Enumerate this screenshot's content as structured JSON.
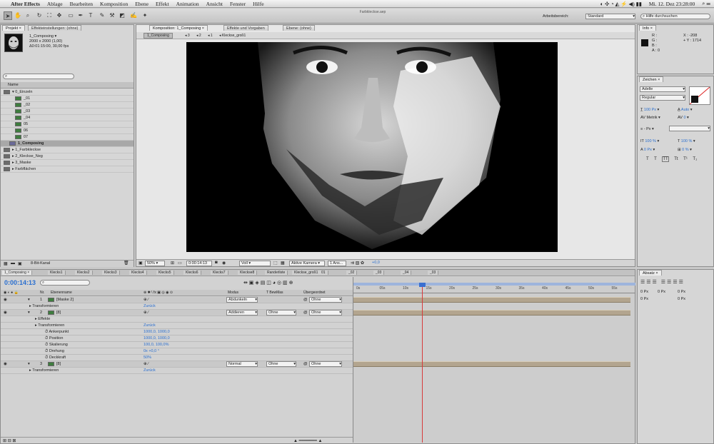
{
  "menubar": {
    "apple": "",
    "app": "After Effects",
    "items": [
      "Ablage",
      "Bearbeiten",
      "Komposition",
      "Ebene",
      "Effekt",
      "Animation",
      "Ansicht",
      "Fenster",
      "Hilfe"
    ],
    "clock": "Mi. 12. Dez  23:28:00"
  },
  "toolbar": {
    "file_title": "Farbkleckse.aep",
    "workspace_label": "Arbeitsbereich:",
    "workspace_value": "Standard",
    "help_placeholder": "Hilfe durchsuchen"
  },
  "project": {
    "tab1": "Projekt ×",
    "tab2": "Effekteinstellungen: (ohne)",
    "comp_name": "1_Composing ▾",
    "comp_size": "2000 x 2000 (1,00)",
    "comp_dur": "Δ0:01:15:00, 30,00 fps",
    "search_placeholder": "",
    "col_name": "Name",
    "items": [
      {
        "label": "▾ 0_Einzeln",
        "kind": "folder",
        "indent": 0
      },
      {
        "label": "_01",
        "kind": "img",
        "indent": 2
      },
      {
        "label": "_02",
        "kind": "img",
        "indent": 2
      },
      {
        "label": "_03",
        "kind": "img",
        "indent": 2
      },
      {
        "label": "_04",
        "kind": "img",
        "indent": 2
      },
      {
        "label": "05",
        "kind": "img",
        "indent": 2
      },
      {
        "label": "06",
        "kind": "img",
        "indent": 2
      },
      {
        "label": "07",
        "kind": "img",
        "indent": 2
      },
      {
        "label": "1_Composing",
        "kind": "comp",
        "indent": 1,
        "selected": true
      },
      {
        "label": "▸ 1_Farbkleckse",
        "kind": "folder",
        "indent": 0
      },
      {
        "label": "▸ 2_Kleckse_Neg",
        "kind": "folder",
        "indent": 0
      },
      {
        "label": "▸ 3_Maske",
        "kind": "folder",
        "indent": 0
      },
      {
        "label": "▸ Farbflächen",
        "kind": "folder",
        "indent": 0
      }
    ],
    "bpc": "8-Bit-Kanal"
  },
  "comp": {
    "tab1": "Komposition: 1_Composing ×",
    "tab2": "Effekte und Vorgaben",
    "tab3": "Ebene: (ohne)",
    "breadcrumb": [
      "1_Composing",
      "3",
      "2",
      "1",
      "Kleckse_groß1"
    ],
    "zoom": "50%",
    "time": "0:00:14:13",
    "quality": "Voll",
    "camera": "Aktive Kamera",
    "views": "1 Ans...",
    "exposure": "+0,0"
  },
  "info": {
    "tab": "Info ×",
    "r": "R :",
    "g": "G :",
    "b": "B :",
    "a": "A :  0",
    "x": "X : -208",
    "y": "+ Y : 1714"
  },
  "zeichen": {
    "tab": "Zeichen ×",
    "font": "Adelle",
    "style": "Regular",
    "size": "100 Px",
    "leading": "Auto",
    "kerning": "Metrik",
    "tracking": "0",
    "stroke": "- Px",
    "vscale": "100 %",
    "hscale": "100 %",
    "baseline": "0 Px",
    "tsume": "0 %",
    "styles": [
      "T",
      "T",
      "TT",
      "Tt",
      "T¹",
      "T₁"
    ]
  },
  "absatz": {
    "tab": "Absatz ×",
    "v1": "0 Px",
    "v2": "0 Px",
    "v3": "0 Px",
    "v4": "0 Px",
    "v5": "0 Px"
  },
  "timeline": {
    "tabs": [
      "1_Composing ×",
      "Klecks1",
      "Klecks2",
      "Klecks3",
      "Klecks4",
      "Klecks5",
      "Klecks6",
      "Klecks7",
      "Kleckse8",
      "Randerliste",
      "Kleckse_groß1",
      "01",
      "_02",
      "_03",
      "_04",
      "_03"
    ],
    "time": "0:00:14:13",
    "cols": {
      "num": "Nr.",
      "name": "Ebenenname",
      "switches": "⊕ ✱ \\ fx ▣ ◎ ◉ ⊙",
      "mode": "Modus",
      "trkmat": "T BewMas",
      "parent": "Übergeordnet"
    },
    "ruler": [
      "0s",
      "05s",
      "10s",
      "15s",
      "20s",
      "25s",
      "30s",
      "35s",
      "40s",
      "45s",
      "50s",
      "55s"
    ],
    "rows": [
      {
        "num": "1",
        "name": "[Maske 2]",
        "mode": "Abdunkeln",
        "trk": "",
        "parent": "Ohne",
        "type": "layer"
      },
      {
        "name": "Transformieren",
        "value": "Zurück",
        "type": "group"
      },
      {
        "num": "2",
        "name": "[8]",
        "mode": "Addieren",
        "trk": "Ohne",
        "parent": "Ohne",
        "type": "layer"
      },
      {
        "name": "Effekte",
        "type": "sub"
      },
      {
        "name": "Transformieren",
        "value": "Zurück",
        "type": "sub"
      },
      {
        "name": "Ankerpunkt",
        "value": "1000,0, 1000,0",
        "type": "prop"
      },
      {
        "name": "Position",
        "value": "1000,0, 1000,0",
        "type": "prop"
      },
      {
        "name": "Skalierung",
        "value": "100,0, 100,0%",
        "type": "prop"
      },
      {
        "name": "Drehung",
        "value": "0x +0,0 °",
        "type": "prop"
      },
      {
        "name": "Deckkraft",
        "value": "50%",
        "type": "prop"
      },
      {
        "num": "3",
        "name": "[8]",
        "mode": "Normal",
        "trk": "Ohne",
        "parent": "Ohne",
        "type": "layer"
      },
      {
        "name": "Transformieren",
        "value": "Zurück",
        "type": "group"
      }
    ]
  },
  "colors": {
    "layer_bar": "#b3a58f",
    "cti": "#d83a3a",
    "accent": "#2a6fd0"
  }
}
